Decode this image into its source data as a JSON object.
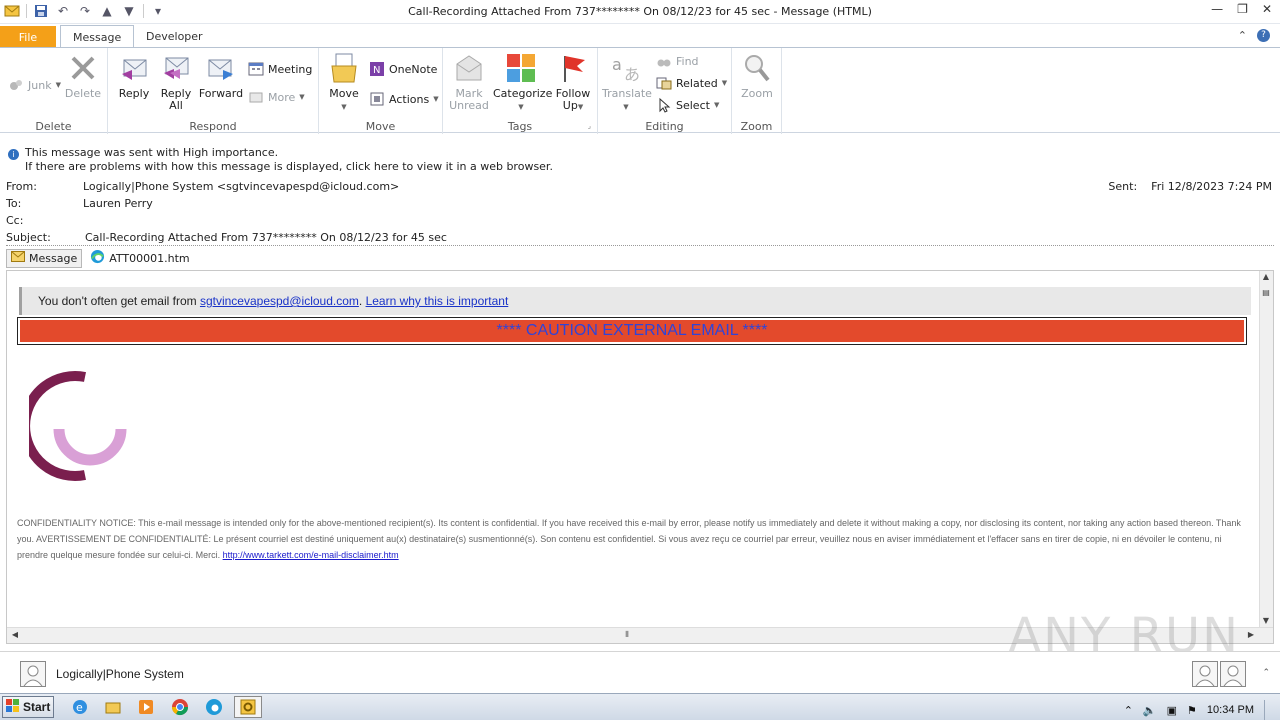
{
  "window": {
    "title": "Call-Recording Attached From 737******** On 08/12/23 for 45 sec  -  Message (HTML)"
  },
  "tabs": {
    "file": "File",
    "message": "Message",
    "developer": "Developer"
  },
  "ribbon": {
    "delete_group": {
      "label": "Delete",
      "junk": "Junk",
      "delete": "Delete"
    },
    "respond_group": {
      "label": "Respond",
      "reply": "Reply",
      "reply_all_1": "Reply",
      "reply_all_2": "All",
      "forward": "Forward",
      "meeting": "Meeting",
      "more": "More"
    },
    "move_group": {
      "label": "Move",
      "move": "Move",
      "onenote": "OneNote",
      "actions": "Actions"
    },
    "tags_group": {
      "label": "Tags",
      "mark_unread_1": "Mark",
      "mark_unread_2": "Unread",
      "categorize": "Categorize",
      "follow_up_1": "Follow",
      "follow_up_2": "Up"
    },
    "editing_group": {
      "label": "Editing",
      "translate": "Translate",
      "find": "Find",
      "related": "Related",
      "select": "Select"
    },
    "zoom_group": {
      "label": "Zoom",
      "zoom": "Zoom"
    }
  },
  "info": {
    "importance": "This message was sent with High importance.",
    "problems": "If there are problems with how this message is displayed, click here to view it in a web browser."
  },
  "header": {
    "from_label": "From:",
    "from_value": "Logically|Phone System <sgtvincevapespd@icloud.com>",
    "to_label": "To:",
    "to_value": "Lauren Perry",
    "cc_label": "Cc:",
    "subject_label": "Subject:",
    "subject_value": "Call-Recording Attached From 737******** On 08/12/23 for 45 sec",
    "sent_label": "Sent:",
    "sent_value": "Fri 12/8/2023 7:24 PM"
  },
  "attachments": {
    "message": "Message",
    "file": "ATT00001.htm"
  },
  "body": {
    "warn_prefix": "You don't often get email from ",
    "warn_email": "sgtvincevapespd@icloud.com",
    "warn_sep": ". ",
    "warn_link": "Learn why this is important",
    "caution": "**** CAUTION EXTERNAL EMAIL ****",
    "notice": "CONFIDENTIALITY NOTICE: This e-mail message is intended only for the above-mentioned recipient(s). Its content is confidential. If you have received this e-mail by error, please notify us immediately and delete it without making a copy, nor disclosing its content, nor taking any action based thereon. Thank you. AVERTISSEMENT DE CONFIDENTIALITÉ: Le présent courriel est destiné uniquement au(x) destinataire(s) susmentionné(s). Son contenu est confidentiel. Si vous avez reçu ce courriel par erreur, veuillez nous en aviser immédiatement et l'effacer sans en tirer de copie, ni en dévoiler le contenu, ni prendre quelque mesure fondée sur celui-ci. Merci. ",
    "notice_link": "http://www.tarkett.com/e-mail-disclaimer.htm"
  },
  "people": {
    "name": "Logically|Phone System"
  },
  "taskbar": {
    "start": "Start",
    "clock": "10:34 PM"
  },
  "watermark": "ANY RUN",
  "colors": {
    "file_tab": "#f4a018",
    "caution_bg": "#e34a2c",
    "caution_text": "#3044d8",
    "logo_dark": "#7a1f4e",
    "logo_light": "#d9a0d6"
  }
}
